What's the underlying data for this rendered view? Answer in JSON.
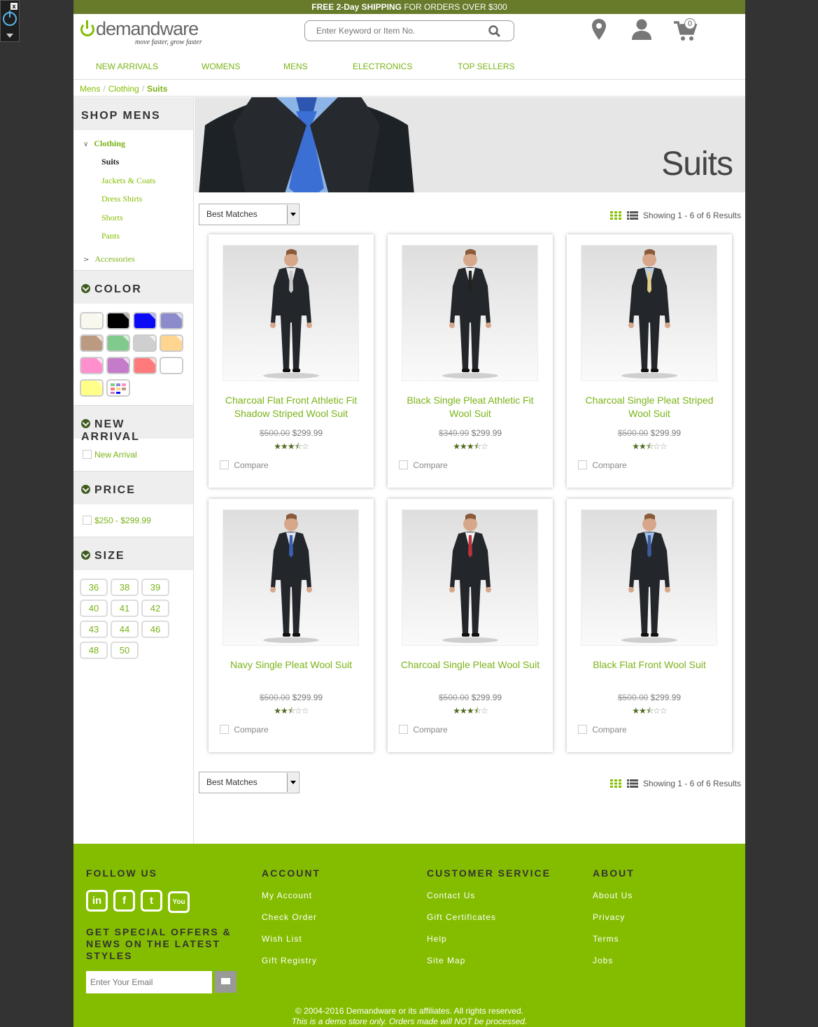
{
  "banner": {
    "bold": "FREE 2-Day SHIPPING",
    "rest": " FOR ORDERS OVER $300"
  },
  "logo": {
    "pre": "",
    "word": "demandware",
    "tagline": "move faster, grow faster"
  },
  "search": {
    "placeholder": "Enter Keyword or Item No."
  },
  "cart": {
    "count": "0"
  },
  "nav": [
    "NEW ARRIVALS",
    "WOMENS",
    "MENS",
    "ELECTRONICS",
    "TOP SELLERS"
  ],
  "breadcrumb": [
    "Mens",
    "Clothing",
    "Suits"
  ],
  "sidebar": {
    "shop_title": "SHOP MENS",
    "category": "Clothing",
    "subcategories": [
      "Suits",
      "Jackets & Coats",
      "Dress Shirts",
      "Shorts",
      "Pants"
    ],
    "other_category": "Accessories",
    "color_title": "COLOR",
    "colors": [
      "#f8f8ee",
      "#000000",
      "#0a0af5",
      "#8c8ccc",
      "#bb9a81",
      "#7fca8c",
      "#cfcfd0",
      "#ffd590",
      "#ff8fcd",
      "#c47cca",
      "#ff7a7a",
      "#ffffff",
      "#ffff8a",
      "multi"
    ],
    "new_arrival_title": "NEW ARRIVAL",
    "new_arrival_option": "New Arrival",
    "price_title": "PRICE",
    "price_option": "$250 - $299.99",
    "size_title": "SIZE",
    "sizes": [
      "36",
      "38",
      "39",
      "40",
      "41",
      "42",
      "43",
      "44",
      "46",
      "48",
      "50"
    ]
  },
  "hero": {
    "title": "Suits"
  },
  "sort": {
    "selected": "Best Matches",
    "results": "Showing 1 - 6 of 6 Results"
  },
  "products": [
    {
      "name": "Charcoal Flat Front Athletic Fit Shadow Striped Wool Suit",
      "old_price": "$500.00",
      "price": "$299.99",
      "rating": 3.5,
      "tie": "#c8c8c8",
      "shirt": "#e8e8e8",
      "compare": "Compare"
    },
    {
      "name": "Black Single Pleat Athletic Fit Wool Suit",
      "old_price": "$349.99",
      "price": "$299.99",
      "rating": 3.5,
      "tie": "#222222",
      "shirt": "#f0f0f0",
      "compare": "Compare"
    },
    {
      "name": "Charcoal Single Pleat Striped Wool Suit",
      "old_price": "$500.00",
      "price": "$299.99",
      "rating": 2.5,
      "tie": "#e3d18a",
      "shirt": "#b9cfe8",
      "compare": "Compare"
    },
    {
      "name": "Navy Single Pleat Wool Suit",
      "old_price": "$500.00",
      "price": "$299.99",
      "rating": 2.5,
      "tie": "#3a5fb0",
      "shirt": "#dde4f0",
      "compare": "Compare"
    },
    {
      "name": "Charcoal Single Pleat Wool Suit",
      "old_price": "$500.00",
      "price": "$299.99",
      "rating": 3.5,
      "tie": "#b8333a",
      "shirt": "#f2f2f2",
      "compare": "Compare"
    },
    {
      "name": "Black Flat Front Wool Suit",
      "old_price": "$500.00",
      "price": "$299.99",
      "rating": 2.5,
      "tie": "#3e5a9a",
      "shirt": "#9fc0ea",
      "compare": "Compare"
    }
  ],
  "footer": {
    "follow_title": "FOLLOW US",
    "social": [
      "in",
      "f",
      "t",
      "You"
    ],
    "offers": "GET SPECIAL OFFERS & NEWS ON THE LATEST STYLES",
    "email_placeholder": "Enter Your Email",
    "account": {
      "title": "ACCOUNT",
      "links": [
        "My Account",
        "Check Order",
        "Wish List",
        "Gift Registry"
      ]
    },
    "service": {
      "title": "CUSTOMER SERVICE",
      "links": [
        "Contact Us",
        "Gift Certificates",
        "Help",
        "Site Map"
      ]
    },
    "about": {
      "title": "ABOUT",
      "links": [
        "About Us",
        "Privacy",
        "Terms",
        "Jobs"
      ]
    },
    "copyright": "© 2004-2016 Demandware or its affiliates. All rights reserved.",
    "demo_note": "This is a demo store only. Orders made will NOT be processed."
  }
}
